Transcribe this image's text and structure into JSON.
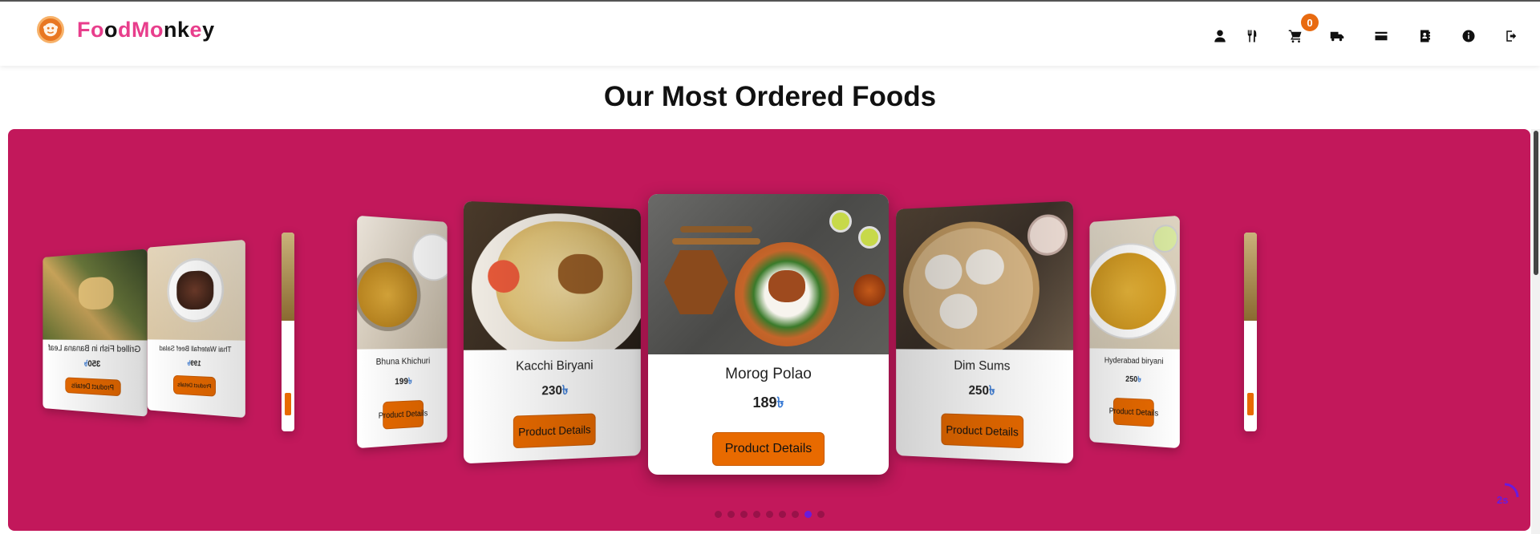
{
  "brand": {
    "letters": [
      "F",
      "o",
      "o",
      "d",
      "M",
      "o",
      "n",
      "k",
      "e",
      "y"
    ]
  },
  "nav": {
    "icons": [
      "user-icon",
      "utensils-icon",
      "cart-icon",
      "truck-icon",
      "credit-card-icon",
      "contact-book-icon",
      "info-icon",
      "sign-out-icon"
    ],
    "cart_count": "0"
  },
  "page": {
    "title": "Our Most Ordered Foods"
  },
  "carousel": {
    "cards": [
      {
        "name": "Morog Polao",
        "price": "189",
        "currency": "৳",
        "button": "Product Details"
      },
      {
        "name": "Kacchi Biryani",
        "price": "230",
        "currency": "৳",
        "button": "Product Details"
      },
      {
        "name": "Dim Sums",
        "price": "250",
        "currency": "৳",
        "button": "Product Details"
      },
      {
        "name": "Bhuna Khichuri",
        "price": "199",
        "currency": "৳",
        "button": "Product Details"
      },
      {
        "name": "Hyderabad biryani",
        "price": "250",
        "currency": "৳",
        "button": "Product Details"
      },
      {
        "name": "Thai Waterfall Beef Salad",
        "price": "199",
        "currency": "৳",
        "button": "Product Details"
      },
      {
        "name": "Grilled Fish in Banana Leaf",
        "price": "350",
        "currency": "৳",
        "button": "Product Details"
      }
    ],
    "dots": 9,
    "active_dot": 8,
    "timer_label": "2s"
  },
  "colors": {
    "accent": "#c2185b",
    "button": "#e86a00",
    "brand_pink": "#e83e8c",
    "brand_dark": "#111111"
  }
}
